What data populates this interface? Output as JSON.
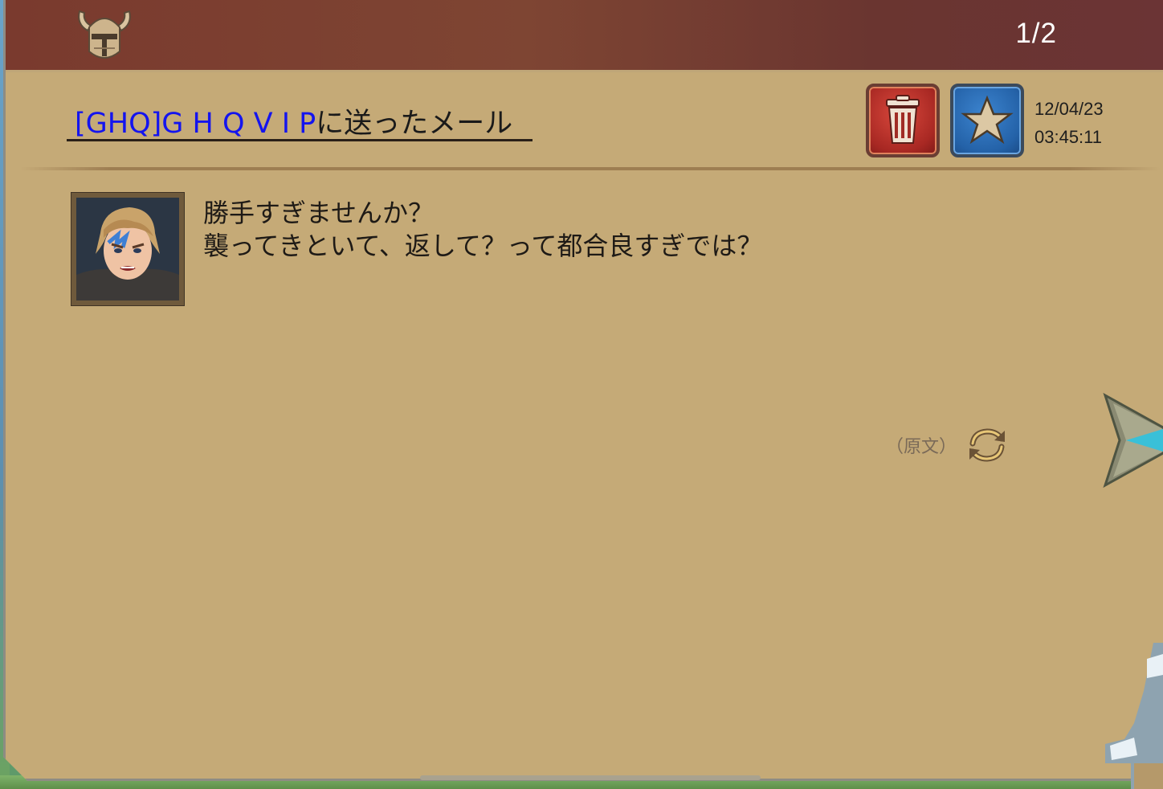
{
  "header": {
    "page_counter": "1/2",
    "icon": "helmet-icon"
  },
  "mail": {
    "recipient": "[GHQ]G H Q V I P",
    "subject_suffix": "に送ったメール",
    "date": "12/04/23",
    "time": "03:45:11",
    "actions": {
      "delete_icon": "trash-icon",
      "favorite_icon": "star-icon"
    }
  },
  "message": {
    "lines": [
      "勝手すぎませんか？",
      "襲ってきといて、返して？って都合良すぎでは？"
    ]
  },
  "translation": {
    "label": "（原文）",
    "icon": "refresh-icon"
  },
  "navigation": {
    "next_icon": "arrow-right-icon"
  },
  "colors": {
    "header": "#7a3a2e",
    "panel": "#c5aa77",
    "recipient_link": "#1414ee",
    "delete_button": "#b8302a",
    "favorite_button": "#2a6ab3"
  }
}
